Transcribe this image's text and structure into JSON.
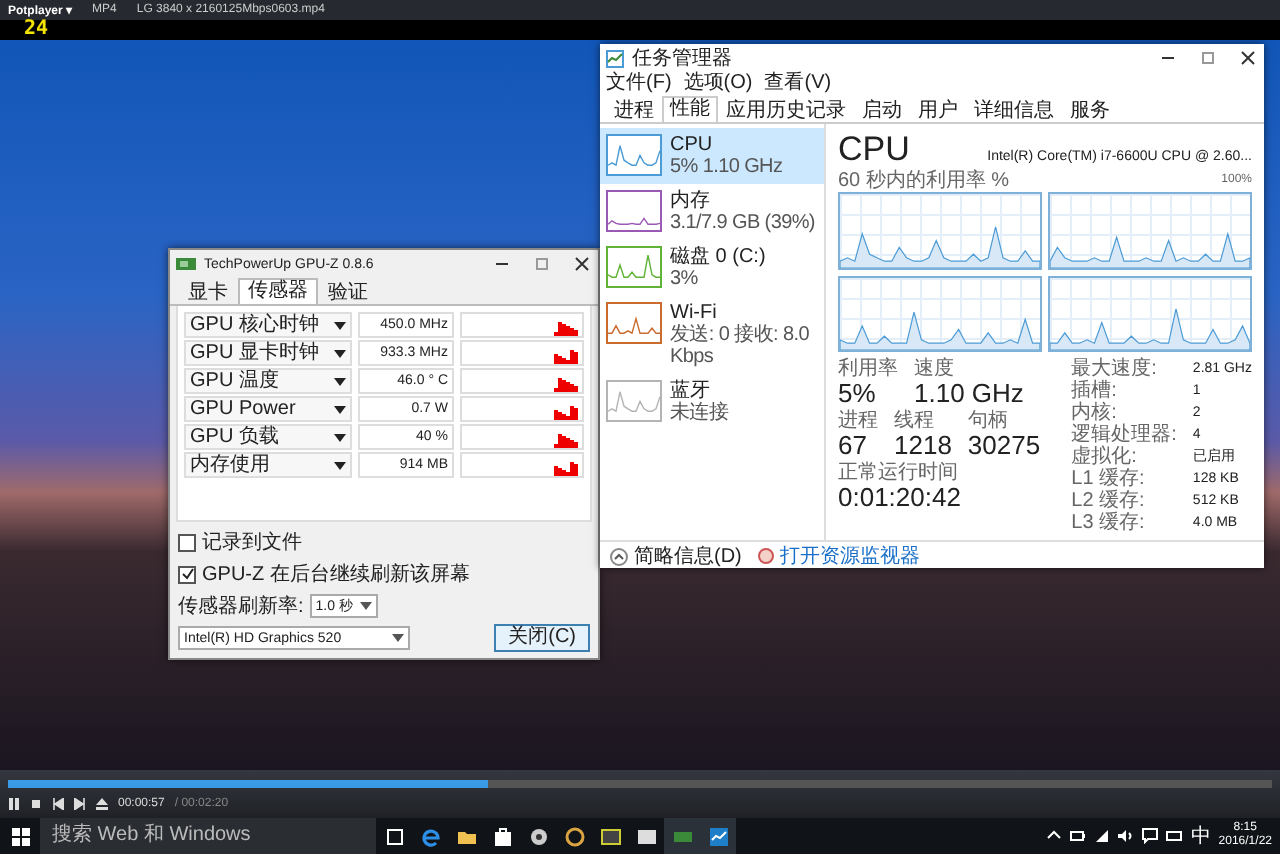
{
  "player": {
    "app_menu": "Potplayer ▾",
    "format": "MP4",
    "file": "LG 3840 x 2160125Mbps0603.mp4",
    "fps": "24",
    "seek": {
      "level": 0.38
    },
    "elapsed": "00:00:57",
    "total": "/ 00:02:20"
  },
  "gpuz": {
    "title": "TechPowerUp GPU-Z 0.8.6",
    "tabs": [
      {
        "label": "显卡",
        "selected": false
      },
      {
        "label": "传感器",
        "selected": true
      },
      {
        "label": "验证",
        "selected": false
      }
    ],
    "sensors": [
      {
        "name": "GPU 核心时钟",
        "value": "450.0 MHz"
      },
      {
        "name": "GPU 显卡时钟",
        "value": "933.3 MHz"
      },
      {
        "name": "GPU 温度",
        "value": "46.0 ° C"
      },
      {
        "name": "GPU Power",
        "value": "0.7 W"
      },
      {
        "name": "GPU 负载",
        "value": "40 %"
      },
      {
        "name": "内存使用",
        "value": "914 MB"
      }
    ],
    "log_to_file": {
      "label": "记录到文件",
      "checked": false
    },
    "background_refresh": {
      "label": "GPU-Z 在后台继续刷新该屏幕",
      "checked": true
    },
    "refresh_label": "传感器刷新率:",
    "refresh_value": "1.0 秒",
    "adapter": "Intel(R) HD Graphics 520",
    "close_button": "关闭(C)"
  },
  "task_manager": {
    "title": "任务管理器",
    "menu": [
      "文件(F)",
      "选项(O)",
      "查看(V)"
    ],
    "tabs": [
      {
        "label": "进程",
        "selected": false
      },
      {
        "label": "性能",
        "selected": true
      },
      {
        "label": "应用历史记录",
        "selected": false
      },
      {
        "label": "启动",
        "selected": false
      },
      {
        "label": "用户",
        "selected": false
      },
      {
        "label": "详细信息",
        "selected": false
      },
      {
        "label": "服务",
        "selected": false
      }
    ],
    "resources": [
      {
        "name": "CPU",
        "detail": "5% 1.10 GHz",
        "color": "#4a9bd6",
        "selected": true
      },
      {
        "name": "内存",
        "detail": "3.1/7.9 GB (39%)",
        "color": "#9b59b6",
        "selected": false
      },
      {
        "name": "磁盘 0 (C:)",
        "detail": "3%",
        "color": "#5fb336",
        "selected": false
      },
      {
        "name": "Wi-Fi",
        "detail": "发送: 0 接收: 8.0 Kbps",
        "color": "#c96c2e",
        "selected": false
      },
      {
        "name": "蓝牙",
        "detail": "未连接",
        "color": "#b4b4b4",
        "selected": false
      }
    ],
    "heading": "CPU",
    "processor": "Intel(R) Core(TM) i7-6600U CPU @ 2.60...",
    "graph_caption": "60 秒内的利用率 %",
    "graph_max": "100%",
    "stat_rows": [
      [
        {
          "label": "利用率",
          "value": "5%"
        },
        {
          "label": "速度",
          "value": "1.10 GHz"
        }
      ],
      [
        {
          "label": "进程",
          "value": "67"
        },
        {
          "label": "线程",
          "value": "1218"
        },
        {
          "label": "句柄",
          "value": "30275"
        }
      ],
      [
        {
          "label": "正常运行时间",
          "value": "0:01:20:42"
        }
      ]
    ],
    "details": [
      {
        "label": "最大速度:",
        "value": "2.81 GHz"
      },
      {
        "label": "插槽:",
        "value": "1"
      },
      {
        "label": "内核:",
        "value": "2"
      },
      {
        "label": "逻辑处理器:",
        "value": "4"
      },
      {
        "label": "虚拟化:",
        "value": "已启用"
      },
      {
        "label": "L1 缓存:",
        "value": "128 KB"
      },
      {
        "label": "L2 缓存:",
        "value": "512 KB"
      },
      {
        "label": "L3 缓存:",
        "value": "4.0 MB"
      }
    ],
    "fewer_details": "简略信息(D)",
    "open_monitor": "打开资源监视器"
  },
  "taskbar": {
    "search": "搜索 Web 和 Windows",
    "ime": "中",
    "time": "8:15",
    "date": "2016/1/22"
  }
}
